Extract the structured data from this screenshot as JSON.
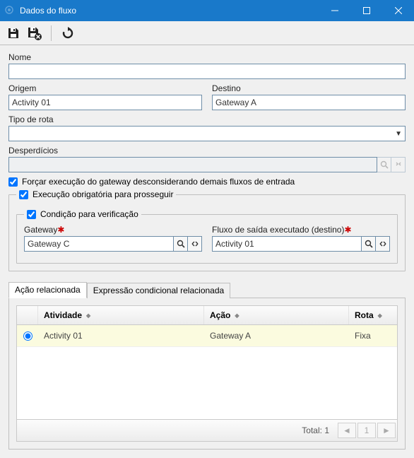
{
  "window": {
    "title": "Dados do fluxo"
  },
  "toolbar": {
    "save": "save",
    "save_close": "save-close",
    "refresh": "refresh"
  },
  "labels": {
    "nome": "Nome",
    "origem": "Origem",
    "destino": "Destino",
    "tipo_rota": "Tipo de rota",
    "desperdicios": "Desperdícios",
    "forcar": "Forçar execução do gateway desconsiderando demais fluxos de entrada",
    "exec_obrig": "Execução obrigatória para prosseguir",
    "cond_verif": "Condição para verificação",
    "gateway": "Gateway",
    "fluxo_saida": "Fluxo de saída executado (destino)",
    "tab_acao": "Ação relacionada",
    "tab_expr": "Expressão condicional relacionada",
    "col_atividade": "Atividade",
    "col_acao": "Ação",
    "col_rota": "Rota",
    "total": "Total: 1"
  },
  "values": {
    "nome": "",
    "origem": "Activity 01",
    "destino": "Gateway A",
    "tipo_rota": "",
    "desperdicios": "",
    "forcar_checked": true,
    "exec_obrig_checked": true,
    "cond_verif_checked": true,
    "gateway": "Gateway C",
    "fluxo_saida": "Activity 01"
  },
  "table": {
    "rows": [
      {
        "selected": true,
        "atividade": "Activity 01",
        "acao": "Gateway A",
        "rota": "Fixa"
      }
    ],
    "total": 1,
    "page": "1"
  }
}
